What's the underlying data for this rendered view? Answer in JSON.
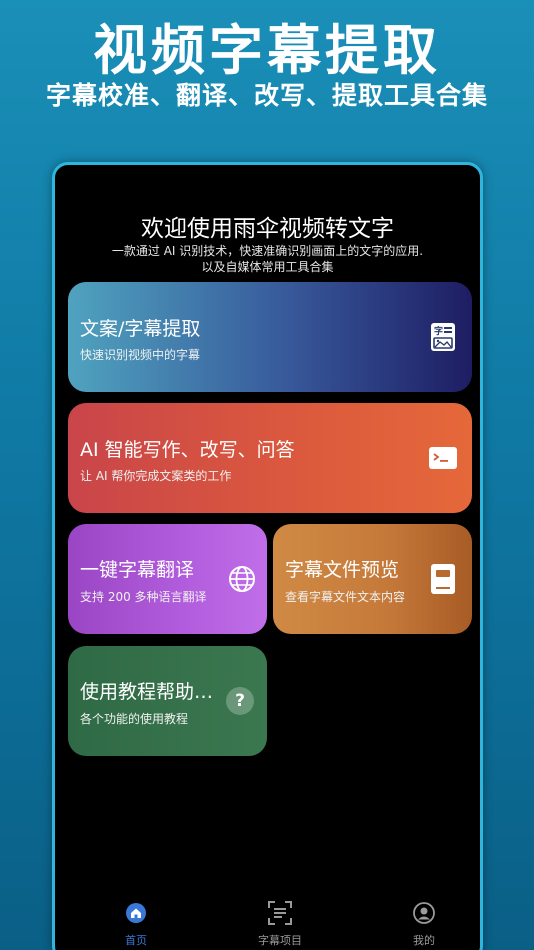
{
  "promo": {
    "title": "视频字幕提取",
    "subtitle": "字幕校准、翻译、改写、提取工具合集"
  },
  "header": {
    "welcome": "欢迎使用雨伞视频转文字",
    "intro_line1": "一款通过 AI 识别技术，快速准确识别画面上的文字的应用.",
    "intro_line2": "以及自媒体常用工具合集"
  },
  "cards": [
    {
      "title": "文案/字幕提取",
      "desc": "快速识别视频中的字幕",
      "icon": "subtitle-image-icon"
    },
    {
      "title": "AI 智能写作、改写、问答",
      "desc": "让 AI 帮你完成文案类的工作",
      "icon": "terminal-icon"
    },
    {
      "title": "一键字幕翻译",
      "desc": "支持 200 多种语言翻译",
      "icon": "globe-icon"
    },
    {
      "title": "字幕文件预览",
      "desc": "查看字幕文件文本内容",
      "icon": "document-icon"
    },
    {
      "title": "使用教程帮助…",
      "desc": "各个功能的使用教程",
      "icon": "help-icon"
    }
  ],
  "tabs": [
    {
      "label": "首页",
      "icon": "home-icon",
      "active": true
    },
    {
      "label": "字幕项目",
      "icon": "scan-text-icon",
      "active": false
    },
    {
      "label": "我的",
      "icon": "user-icon",
      "active": false
    }
  ],
  "colors": {
    "accent": "#3a78d6",
    "phone_border": "#2fb6dc",
    "background": "#1a8fb7"
  }
}
